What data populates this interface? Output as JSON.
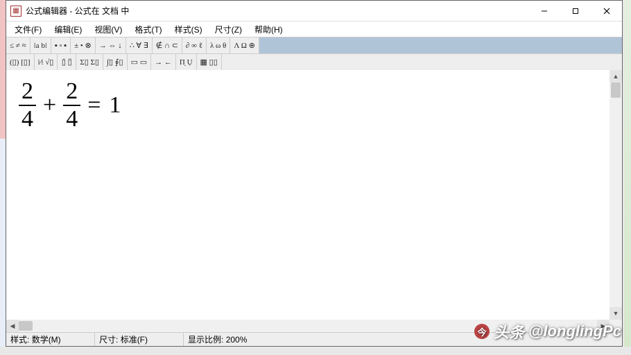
{
  "title": "公式编辑器 - 公式在 文档 中",
  "app_icon_glyph": "▦",
  "menus": [
    {
      "label": "文件(F)"
    },
    {
      "label": "编辑(E)"
    },
    {
      "label": "视图(V)"
    },
    {
      "label": "格式(T)"
    },
    {
      "label": "样式(S)"
    },
    {
      "label": "尺寸(Z)"
    },
    {
      "label": "帮助(H)"
    }
  ],
  "toolbar1": [
    {
      "name": "relations",
      "glyph": "≤ ≠ ≈"
    },
    {
      "name": "spaces-ab",
      "glyph": "⁞a b⁞"
    },
    {
      "name": "primes",
      "glyph": "▪ ▫ ▪"
    },
    {
      "name": "operators",
      "glyph": "± • ⊗"
    },
    {
      "name": "arrows",
      "glyph": "→ ⇔ ↓"
    },
    {
      "name": "logic",
      "glyph": "∴ ∀ ∃"
    },
    {
      "name": "set",
      "glyph": "∉ ∩ ⊂"
    },
    {
      "name": "misc",
      "glyph": "∂ ∞ ℓ"
    },
    {
      "name": "greek-lower",
      "glyph": "λ ω θ"
    },
    {
      "name": "greek-upper",
      "glyph": "Λ Ω ⊕"
    }
  ],
  "toolbar2": [
    {
      "name": "fences",
      "glyph": "(▯) [▯]"
    },
    {
      "name": "fractions",
      "glyph": "⁞∕⁞ √▯"
    },
    {
      "name": "scripts",
      "glyph": "▯̇  ▯̈"
    },
    {
      "name": "summation",
      "glyph": "Σ▯ Σ▯"
    },
    {
      "name": "integrals",
      "glyph": "∫▯ ∮▯"
    },
    {
      "name": "overbar",
      "glyph": "▭ ▭"
    },
    {
      "name": "long-arrows",
      "glyph": "→ ←"
    },
    {
      "name": "products",
      "glyph": "Π̣ Ụ"
    },
    {
      "name": "matrices",
      "glyph": "▦ ▯▯"
    }
  ],
  "formula": {
    "term1": {
      "num": "2",
      "den": "4"
    },
    "plus": "+",
    "term2": {
      "num": "2",
      "den": "4"
    },
    "equals": "=",
    "rhs": "1"
  },
  "status": {
    "style_label": "样式:",
    "style_value": "数学(M)",
    "size_label": "尺寸:",
    "size_value": "标准(F)",
    "zoom_label": "显示比例:",
    "zoom_value": "200%"
  },
  "watermark": {
    "prefix": "头条",
    "handle": "@longlingPc",
    "icon_glyph": "今"
  }
}
